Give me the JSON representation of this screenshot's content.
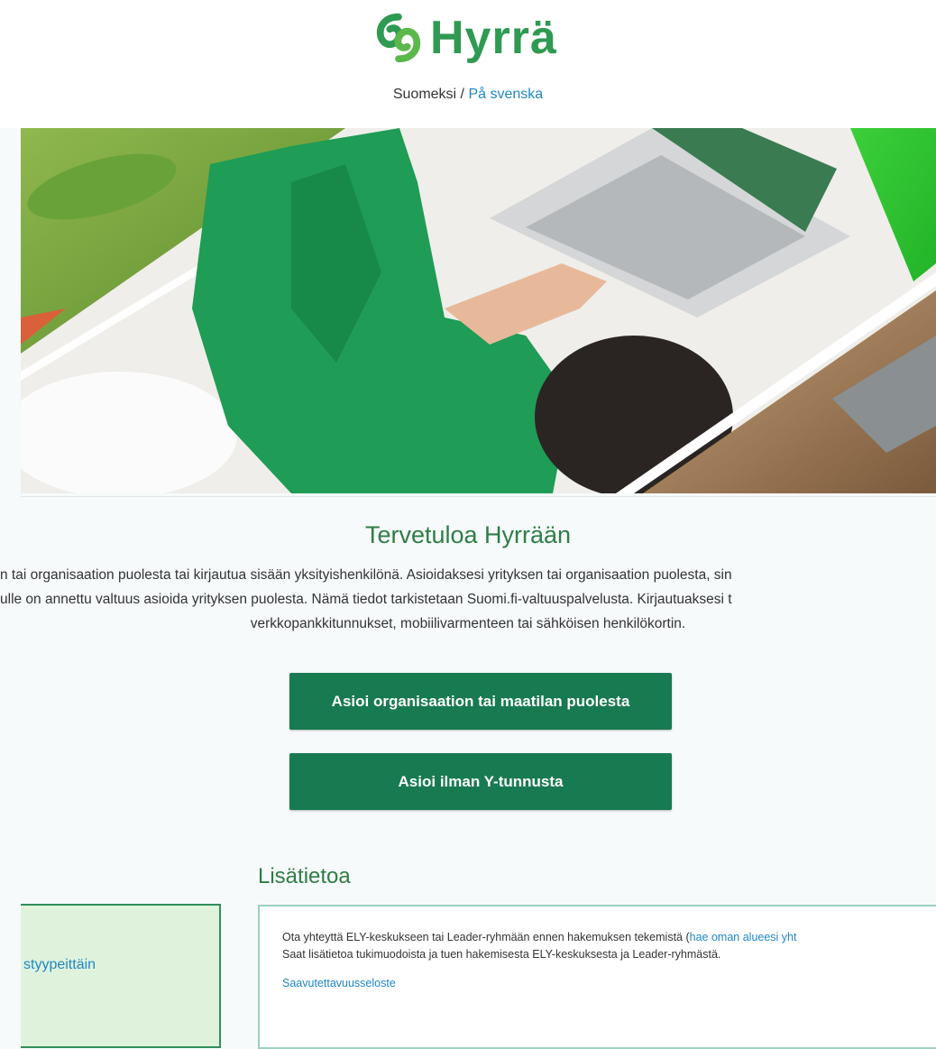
{
  "header": {
    "logo_text": "Hyrrä",
    "lang_current": "Suomeksi",
    "lang_sep": " / ",
    "lang_other": "På svenska"
  },
  "welcome": {
    "title": "Tervetuloa Hyrrään",
    "line1": "n tai organisaation puolesta tai kirjautua sisään yksityishenkilönä. Asioidaksesi yrityksen tai organisaation puolesta, sin",
    "line2": "ulle on annettu valtuus asioida yrityksen puolesta. Nämä tiedot tarkistetaan Suomi.fi-valtuuspalvelusta. Kirjautuaksesi t",
    "line3": "verkkopankkitunnukset, mobiilivarmenteen tai sähköisen henkilökortin."
  },
  "buttons": {
    "org": "Asioi organisaation tai maatilan puolesta",
    "private": "Asioi ilman Y-tunnusta"
  },
  "info": {
    "title": "Lisätietoa",
    "side_link": "styypeittäin",
    "text1_a": "Ota yhteyttä ELY-keskukseen tai Leader-ryhmään ennen hakemuksen tekemistä (",
    "text1_link": "hae oman alueesi yht",
    "text2": "Saat lisätietoa tukimuodoista ja tuen hakemisesta ELY-keskuksesta ja Leader-ryhmästä.",
    "accessibility": "Saavutettavuusseloste"
  },
  "colors": {
    "brand_green": "#2e9a52",
    "button_green": "#187a50",
    "link_blue": "#1f87c4"
  }
}
